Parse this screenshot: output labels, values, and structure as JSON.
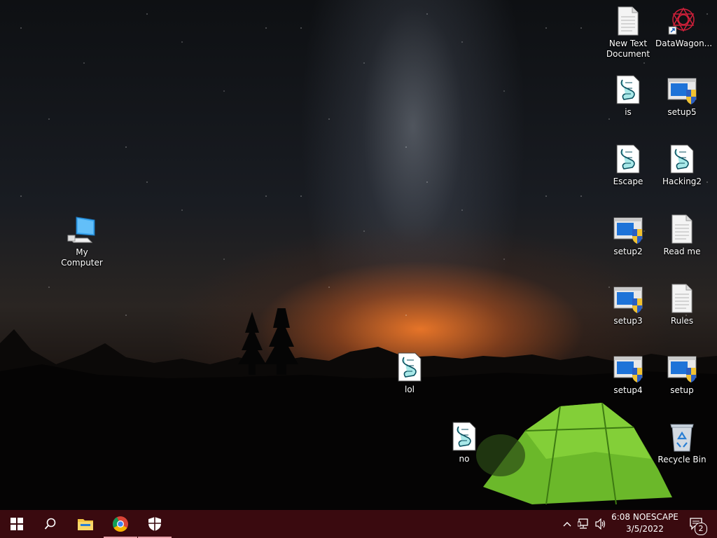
{
  "desktop": {
    "icons": [
      {
        "id": "new-text-document",
        "label": "New Text Document",
        "type": "text"
      },
      {
        "id": "datawagon",
        "label": "DataWagon...",
        "type": "app"
      },
      {
        "id": "is",
        "label": "is",
        "type": "script"
      },
      {
        "id": "setup5",
        "label": "setup5",
        "type": "setup"
      },
      {
        "id": "escape",
        "label": "Escape",
        "type": "script"
      },
      {
        "id": "hacking2",
        "label": "Hacking2",
        "type": "script"
      },
      {
        "id": "my-computer",
        "label": "My Computer",
        "type": "computer"
      },
      {
        "id": "setup2",
        "label": "setup2",
        "type": "setup"
      },
      {
        "id": "read-me",
        "label": "Read me",
        "type": "text"
      },
      {
        "id": "setup3",
        "label": "setup3",
        "type": "setup"
      },
      {
        "id": "rules",
        "label": "Rules",
        "type": "text"
      },
      {
        "id": "lol",
        "label": "lol",
        "type": "script"
      },
      {
        "id": "setup4",
        "label": "setup4",
        "type": "setup"
      },
      {
        "id": "setup",
        "label": "setup",
        "type": "setup"
      },
      {
        "id": "no",
        "label": "no",
        "type": "script"
      },
      {
        "id": "recycle-bin",
        "label": "Recycle Bin",
        "type": "recycle"
      }
    ]
  },
  "taskbar": {
    "color": "#3a0a0f",
    "start_icon": "windows-logo-icon",
    "search_icon": "search-icon",
    "pinned": [
      {
        "id": "file-explorer",
        "icon": "folder-icon"
      },
      {
        "id": "chrome",
        "icon": "chrome-icon"
      },
      {
        "id": "security",
        "icon": "shield-icon"
      }
    ],
    "tray": {
      "chevron_icon": "chevron-up-icon",
      "network_icon": "network-icon",
      "volume_icon": "volume-icon",
      "notification_icon": "notification-icon",
      "notification_count": "2"
    },
    "clock": {
      "time": "6:08 NOESCAPE",
      "date": "3/5/2022"
    }
  }
}
